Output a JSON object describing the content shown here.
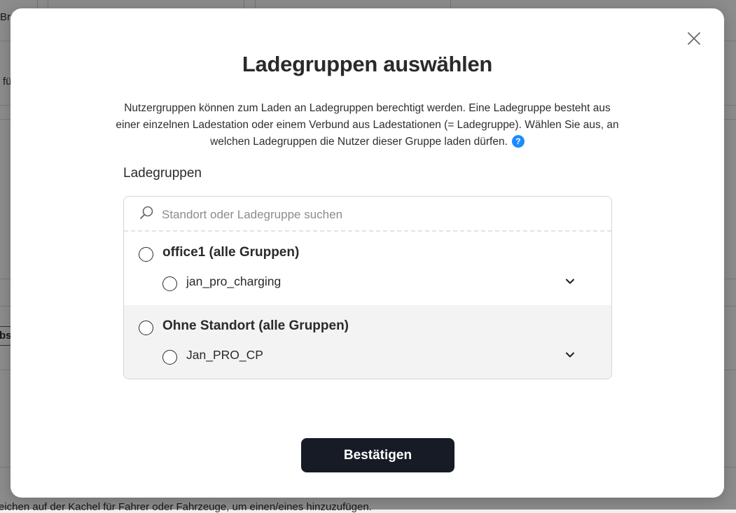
{
  "background": {
    "fragment_top_left": "Bru",
    "fragment_left": "fü",
    "fragment_tab": "bs",
    "bottom_text": "eichen auf der Kachel für Fahrer oder Fahrzeuge, um einen/eines hinzuzufügen."
  },
  "modal": {
    "title": "Ladegruppen auswählen",
    "description": "Nutzergruppen können zum Laden an Ladegruppen berechtigt werden. Eine Ladegruppe besteht aus einer einzelnen Ladestation oder einem Verbund aus Ladestationen (= Ladegruppe). Wählen Sie aus, an welchen Ladegruppen die Nutzer dieser Gruppe laden dürfen.",
    "help_icon_glyph": "?",
    "section_label": "Ladegruppen",
    "search": {
      "placeholder": "Standort oder Ladegruppe suchen",
      "value": ""
    },
    "groups": [
      {
        "label": "office1 (alle Gruppen)",
        "children": [
          {
            "label": "jan_pro_charging"
          }
        ]
      },
      {
        "label": "Ohne Standort (alle Gruppen)",
        "children": [
          {
            "label": "Jan_PRO_CP"
          }
        ]
      }
    ],
    "confirm_label": "Bestätigen"
  },
  "icons": [
    "close-icon",
    "help-icon",
    "search-icon",
    "chevron-down-icon"
  ],
  "colors": {
    "confirm_bg": "#161b26",
    "help_blue": "#1a8cff",
    "alt_row": "#f3f3f3"
  }
}
